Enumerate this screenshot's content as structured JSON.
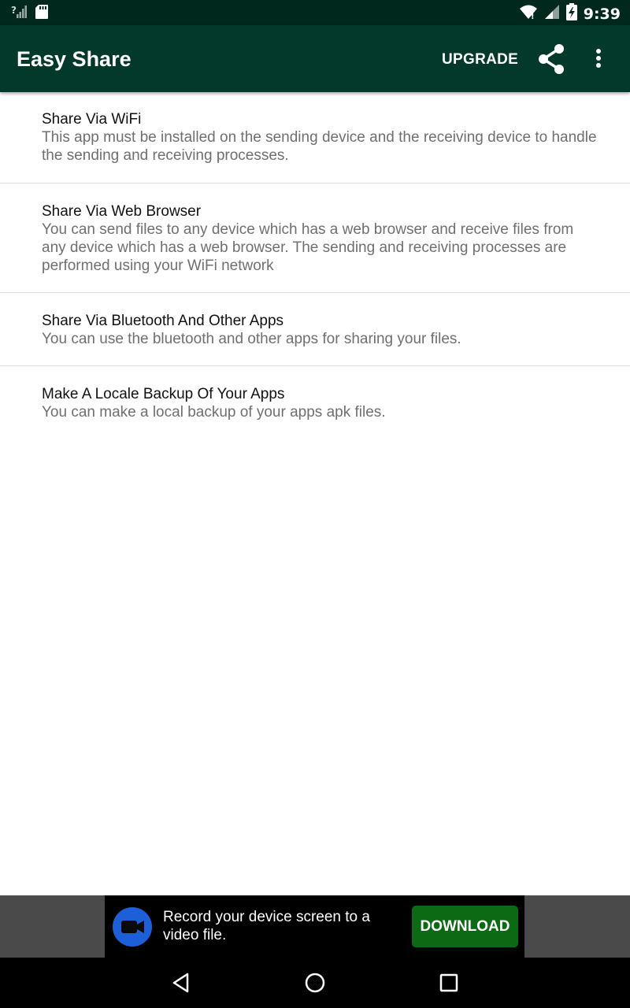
{
  "status_bar": {
    "time": "9:39",
    "icons": [
      "no-signal-icon",
      "sd-card-icon",
      "wifi-icon",
      "signal-icon",
      "battery-charging-icon"
    ]
  },
  "app_bar": {
    "title": "Easy Share",
    "upgrade_label": "UPGRADE",
    "icons": [
      "share-icon",
      "more-vert-icon"
    ]
  },
  "items": [
    {
      "title": "Share Via WiFi",
      "description": "This app must be installed on the sending device and the receiving device to handle the sending and receiving processes."
    },
    {
      "title": "Share Via Web Browser",
      "description": "You can send files to any device which has a web browser and receive files from any device which has a web browser. The sending and receiving processes are performed using your WiFi network"
    },
    {
      "title": "Share Via Bluetooth And Other Apps",
      "description": "You can use the bluetooth and other apps for sharing your files."
    },
    {
      "title": "Make A Locale Backup Of Your Apps",
      "description": "You can make a local backup of your apps apk files."
    }
  ],
  "ad": {
    "text": "Record your device screen to a video file.",
    "button_label": "DOWNLOAD",
    "icon": "video-camera-icon"
  },
  "nav_bar": {
    "icons": [
      "back-icon",
      "home-icon",
      "recents-icon"
    ]
  },
  "colors": {
    "status_bar": "#01281d",
    "app_bar": "#03392a",
    "download_button": "#0d6a14",
    "ad_icon": "#1d5fd6"
  }
}
